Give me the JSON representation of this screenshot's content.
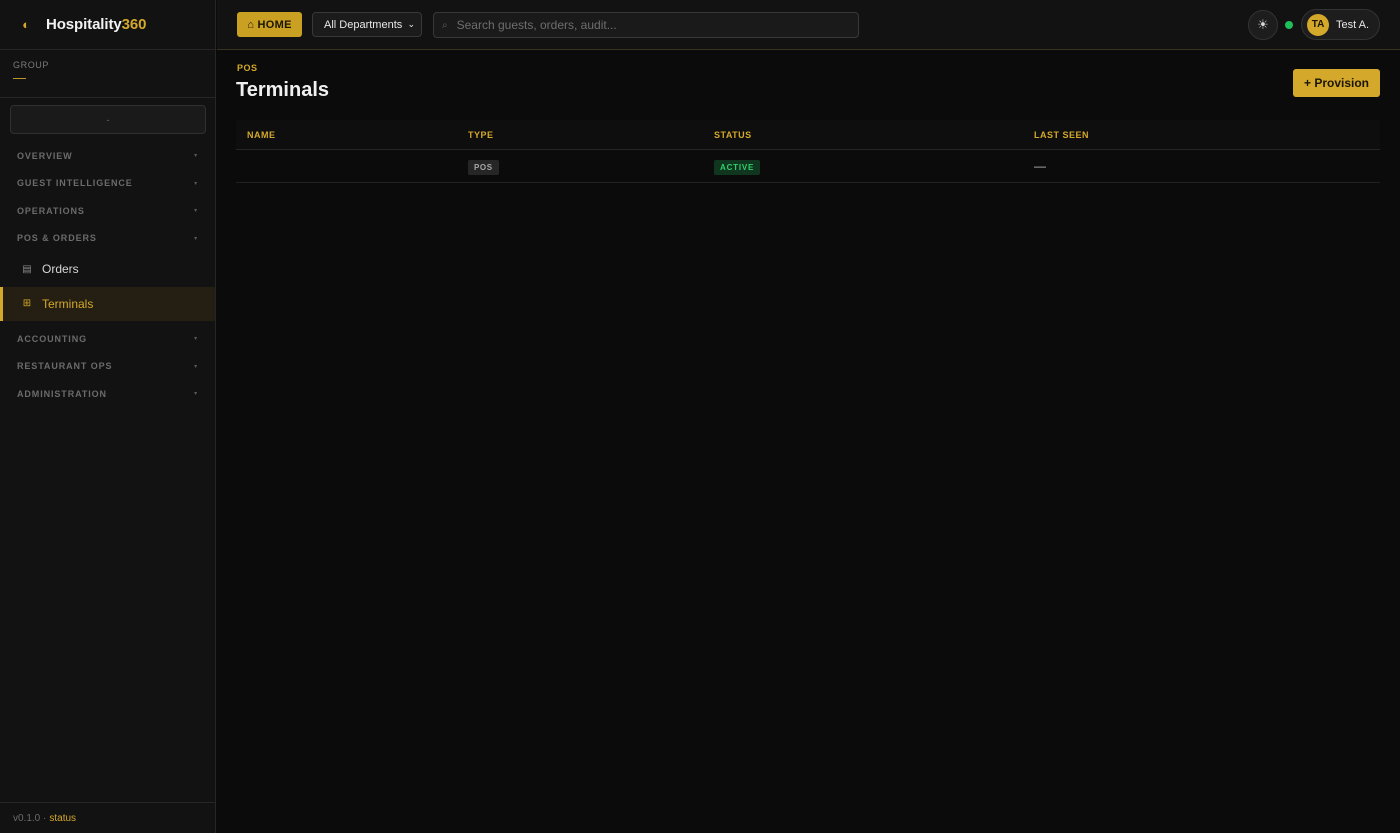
{
  "brand": {
    "name": "Hospitality",
    "accent": "360",
    "accent_color": "#d4a82a"
  },
  "sidebar": {
    "group_label": "GROUP",
    "group_value": "—",
    "property_select": "-",
    "sections": [
      {
        "label": "OVERVIEW"
      },
      {
        "label": "GUEST INTELLIGENCE"
      },
      {
        "label": "OPERATIONS"
      },
      {
        "label": "POS & ORDERS"
      },
      {
        "label": "ACCOUNTING"
      },
      {
        "label": "RESTAURANT OPS"
      },
      {
        "label": "ADMINISTRATION"
      }
    ],
    "items": [
      {
        "label": "Orders",
        "icon": "list-icon"
      },
      {
        "label": "Terminals",
        "icon": "grid-icon"
      }
    ],
    "caret": "▾",
    "footer": {
      "version": "v0.1.0 ·",
      "status_link": "status"
    }
  },
  "topbar": {
    "home_label": "⌂ HOME",
    "department": "All Departments",
    "search_placeholder": "Search guests, orders, audit...",
    "theme_icon": "☀",
    "user_initials": "TA",
    "user_name": "Test A."
  },
  "page": {
    "breadcrumb": "POS",
    "title": "Terminals",
    "provision_label": "+ Provision"
  },
  "table": {
    "columns": [
      "NAME",
      "TYPE",
      "STATUS",
      "LAST SEEN"
    ],
    "rows": [
      {
        "name": "",
        "type": "POS",
        "status": "ACTIVE",
        "last_seen": "—"
      }
    ]
  },
  "colors": {
    "accent": "#d4a82a",
    "success": "#2fcf6b",
    "background": "#0b0b0b"
  }
}
